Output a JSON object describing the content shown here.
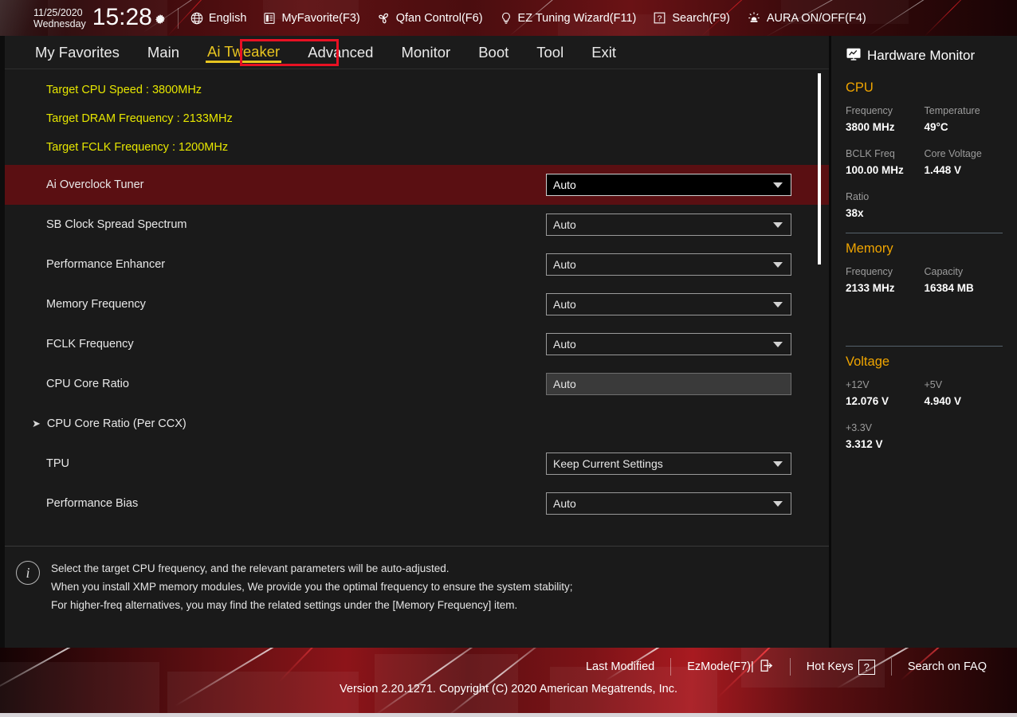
{
  "topbar": {
    "date": "11/25/2020",
    "weekday": "Wednesday",
    "time": "15:28",
    "gear_icon": "gear-icon",
    "items": [
      {
        "label": "English",
        "icon": "globe-icon"
      },
      {
        "label": "MyFavorite(F3)",
        "icon": "favorite-list-icon"
      },
      {
        "label": "Qfan Control(F6)",
        "icon": "fan-icon"
      },
      {
        "label": "EZ Tuning Wizard(F11)",
        "icon": "lightbulb-icon"
      },
      {
        "label": "Search(F9)",
        "icon": "question-box-icon"
      },
      {
        "label": "AURA ON/OFF(F4)",
        "icon": "aura-light-icon"
      }
    ]
  },
  "menubar": {
    "items": [
      {
        "label": "My Favorites",
        "active": false
      },
      {
        "label": "Main",
        "active": false
      },
      {
        "label": "Ai Tweaker",
        "active": true
      },
      {
        "label": "Advanced",
        "active": false
      },
      {
        "label": "Monitor",
        "active": false
      },
      {
        "label": "Boot",
        "active": false
      },
      {
        "label": "Tool",
        "active": false
      },
      {
        "label": "Exit",
        "active": false
      }
    ],
    "highlight_color": "#e81123",
    "active_color": "#e8c520"
  },
  "content": {
    "targets": [
      "Target CPU Speed : 3800MHz",
      "Target DRAM Frequency : 2133MHz",
      "Target FCLK Frequency : 1200MHz"
    ],
    "targets_color": "#e6e600",
    "selected_row_color": "#5a0f12",
    "rows": [
      {
        "label": "Ai Overclock Tuner",
        "value": "Auto",
        "control": "select",
        "selected": true,
        "submenu": false
      },
      {
        "label": "SB Clock Spread Spectrum",
        "value": "Auto",
        "control": "select",
        "selected": false,
        "submenu": false
      },
      {
        "label": "Performance Enhancer",
        "value": "Auto",
        "control": "select",
        "selected": false,
        "submenu": false
      },
      {
        "label": "Memory Frequency",
        "value": "Auto",
        "control": "select",
        "selected": false,
        "submenu": false
      },
      {
        "label": "FCLK Frequency",
        "value": "Auto",
        "control": "select",
        "selected": false,
        "submenu": false
      },
      {
        "label": "CPU Core Ratio",
        "value": "Auto",
        "control": "text",
        "selected": false,
        "submenu": false
      },
      {
        "label": "CPU Core Ratio (Per CCX)",
        "value": "",
        "control": "none",
        "selected": false,
        "submenu": true
      },
      {
        "label": "TPU",
        "value": "Keep Current Settings",
        "control": "select",
        "selected": false,
        "submenu": false
      },
      {
        "label": "Performance Bias",
        "value": "Auto",
        "control": "select",
        "selected": false,
        "submenu": false
      }
    ]
  },
  "help": {
    "icon": "info-icon",
    "lines": [
      "Select the target CPU frequency, and the relevant parameters will be auto-adjusted.",
      "When you install XMP memory modules, We provide you the optimal frequency to ensure the system stability;",
      "For higher-freq alternatives, you may find the related settings under the [Memory Frequency] item."
    ]
  },
  "hardware_monitor": {
    "title": "Hardware Monitor",
    "icon": "monitor-chart-icon",
    "section_color": "#f0a500",
    "sections": [
      {
        "name": "CPU",
        "pairs": [
          [
            {
              "key": "Frequency",
              "value": "3800 MHz"
            },
            {
              "key": "Temperature",
              "value": "49°C"
            }
          ],
          [
            {
              "key": "BCLK Freq",
              "value": "100.00 MHz"
            },
            {
              "key": "Core Voltage",
              "value": "1.448 V"
            }
          ],
          [
            {
              "key": "Ratio",
              "value": "38x"
            }
          ]
        ]
      },
      {
        "name": "Memory",
        "pairs": [
          [
            {
              "key": "Frequency",
              "value": "2133 MHz"
            },
            {
              "key": "Capacity",
              "value": "16384 MB"
            }
          ]
        ]
      },
      {
        "name": "Voltage",
        "pairs": [
          [
            {
              "key": "+12V",
              "value": "12.076 V"
            },
            {
              "key": "+5V",
              "value": "4.940 V"
            }
          ],
          [
            {
              "key": "+3.3V",
              "value": "3.312 V"
            }
          ]
        ]
      }
    ]
  },
  "footer": {
    "actions": [
      {
        "label": "Last Modified",
        "icon": ""
      },
      {
        "label": "EzMode(F7)|",
        "icon": "exit-arrow-icon"
      },
      {
        "label": "Hot Keys",
        "icon": "question-key-icon"
      },
      {
        "label": "Search on FAQ",
        "icon": ""
      }
    ],
    "version": "Version 2.20.1271. Copyright (C) 2020 American Megatrends, Inc."
  }
}
